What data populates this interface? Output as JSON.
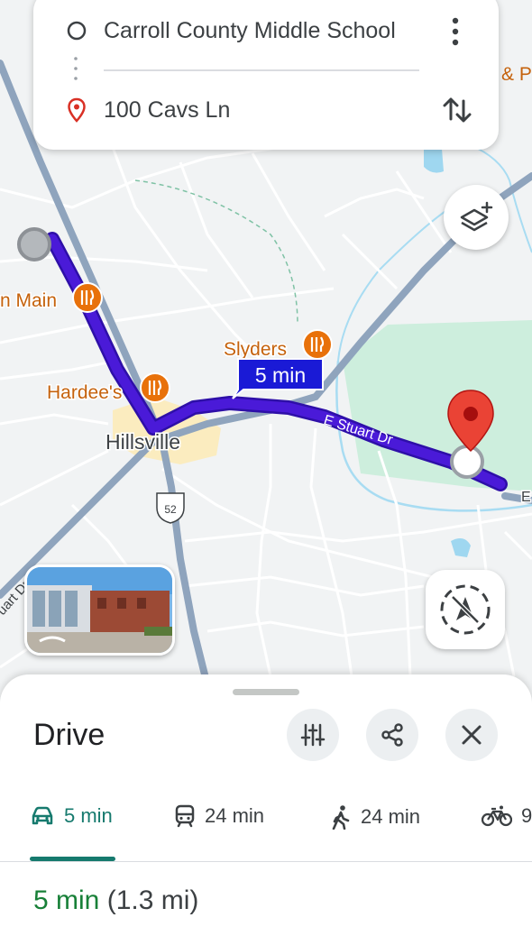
{
  "directions": {
    "origin": "Carroll County Middle School",
    "destination": "100 Cavs Ln"
  },
  "map": {
    "labels": {
      "poi_main": "n Main",
      "poi_slyders": "Slyders",
      "poi_hardees": "Hardee's",
      "town": "Hillsville",
      "street_e_stuart": "E Stuart Dr",
      "street_stuart_left": "uart Dr",
      "street_edge_e": "E",
      "poi_edge_top": "& P",
      "route_badge": "52"
    },
    "route_time_label": "5 min",
    "colors": {
      "route": "#4a1ad8",
      "route_bubble": "#1a1ad6",
      "poi": "#e8710a",
      "park": "#cdeedd",
      "water": "#9fd7f0",
      "major_road": "#8fa4bd",
      "pin": "#d93025"
    }
  },
  "sheet": {
    "title": "Drive",
    "modes": [
      {
        "icon": "car-icon",
        "label": "5 min",
        "active": true
      },
      {
        "icon": "transit-icon",
        "label": "24 min",
        "active": false
      },
      {
        "icon": "walk-icon",
        "label": "24 min",
        "active": false
      },
      {
        "icon": "bike-icon",
        "label": "9",
        "active": false
      }
    ],
    "summary_duration": "5 min",
    "summary_distance": "(1.3 mi)"
  }
}
